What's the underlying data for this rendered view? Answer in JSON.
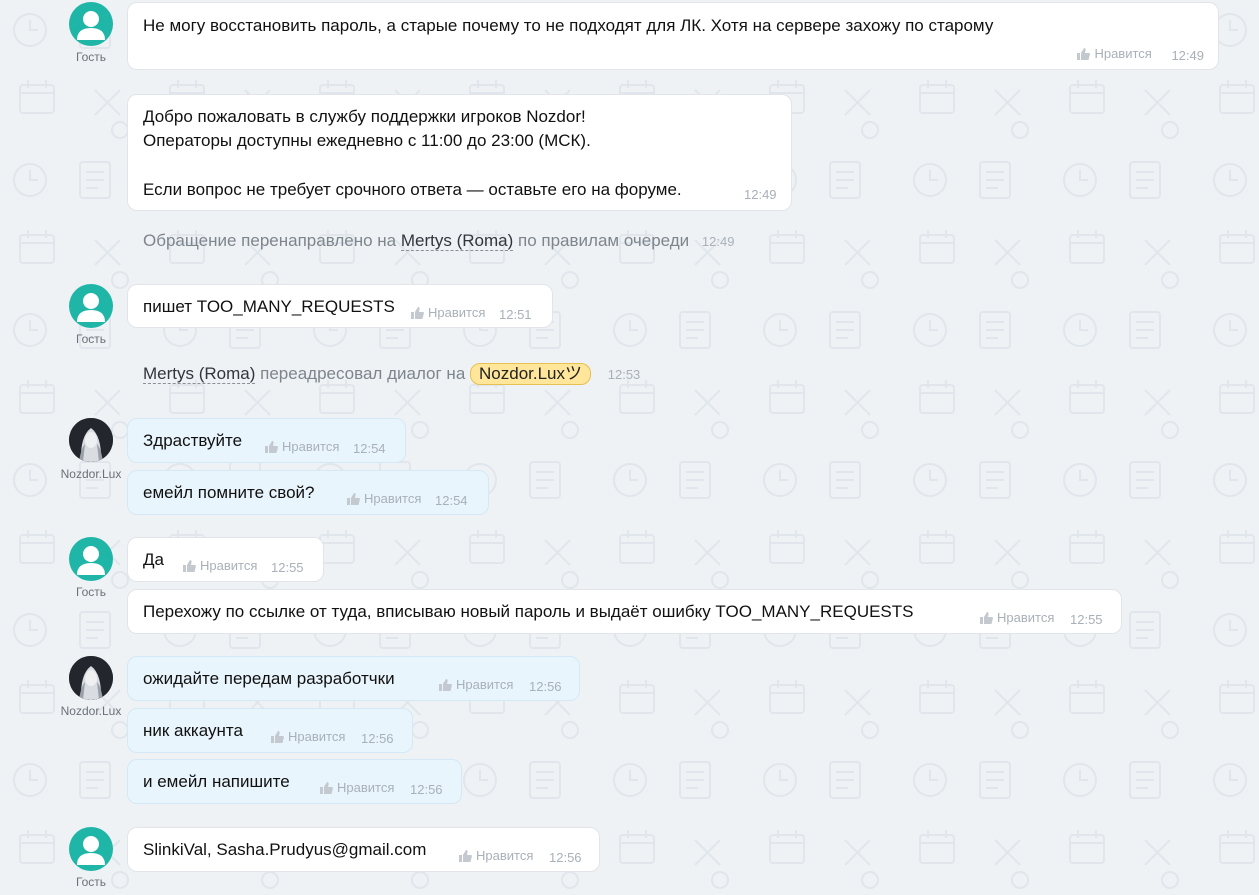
{
  "like_label": "Нравится",
  "messages": [
    {
      "text": "Не могу восстановить пароль, а старые почему то не подходят для ЛК. Хотя на сервере захожу по старому",
      "time": "12:49"
    },
    {
      "lines": [
        "Добро пожаловать в службу поддержки игроков Nozdor!",
        "Операторы доступны ежедневно с 11:00 до 23:00 (МСК).",
        "",
        "Если вопрос не требует срочного ответа — оставьте его на форуме."
      ],
      "time": "12:49"
    },
    {
      "text": "пишет TOO_MANY_REQUESTS",
      "time": "12:51"
    },
    {
      "text": "Здраствуйте",
      "time": "12:54"
    },
    {
      "text": "емейл помните свой?",
      "time": "12:54"
    },
    {
      "text": "Да",
      "time": "12:55"
    },
    {
      "text": "Перехожу по ссылке от туда, вписываю новый пароль и выдаёт ошибку TOO_MANY_REQUESTS",
      "time": "12:55"
    },
    {
      "text": "ожидайте передам разработчки",
      "time": "12:56"
    },
    {
      "text": "ник аккаунта",
      "time": "12:56"
    },
    {
      "text": "и емейл напишите",
      "time": "12:56"
    },
    {
      "text": "SlinkiVal, Sasha.Prudyus@gmail.com",
      "time": "12:56"
    }
  ],
  "system": [
    {
      "before": "Обращение перенаправлено на",
      "operator": "Mertys (Roma)",
      "after": "по правилам очереди",
      "time": "12:49"
    },
    {
      "operator": "Mertys (Roma)",
      "middle": "переадресовал диалог на",
      "target": "Nozdor.Luxツ",
      "time": "12:53"
    }
  ],
  "users": {
    "guest": "Гость",
    "operator": "Nozdor.Lux"
  },
  "icons": {
    "avatar_guest": "user-silhouette-icon",
    "like": "thumbs-up-icon"
  },
  "colors": {
    "guest_avatar": "#1fb5a7",
    "operator_bubble": "#e9f5fc",
    "highlight_tag": "#ffe69a"
  }
}
